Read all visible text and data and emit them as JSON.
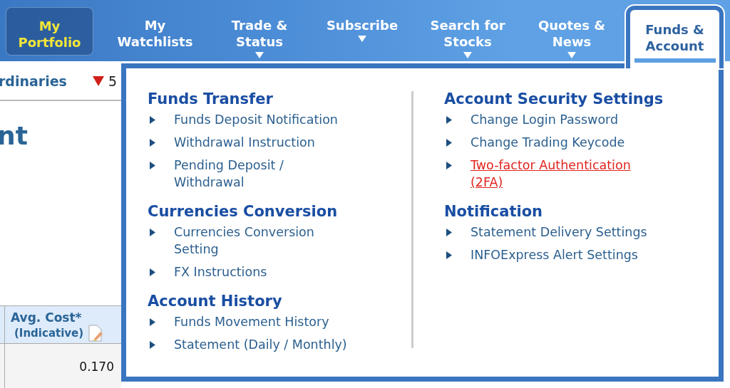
{
  "nav": {
    "tabs": [
      {
        "label": "My\nPortfolio",
        "current": true,
        "selected": false,
        "has_dropdown": false
      },
      {
        "label": "My\nWatchlists",
        "current": false,
        "selected": false,
        "has_dropdown": false
      },
      {
        "label": "Trade &\nStatus",
        "current": false,
        "selected": false,
        "has_dropdown": true
      },
      {
        "label": "Subscribe",
        "current": false,
        "selected": false,
        "has_dropdown": true
      },
      {
        "label": "Search for\nStocks",
        "current": false,
        "selected": false,
        "has_dropdown": true
      },
      {
        "label": "Quotes &\nNews",
        "current": false,
        "selected": false,
        "has_dropdown": true
      },
      {
        "label": "Funds &\nAccount",
        "current": false,
        "selected": true,
        "has_dropdown": false
      }
    ]
  },
  "background_page": {
    "index_name": "rdinaries",
    "index_change": "5",
    "title": "nt",
    "table": {
      "header": {
        "label": "Avg. Cost*",
        "sublabel": "(Indicative)"
      },
      "rows": [
        {
          "avg_cost": "0.170"
        }
      ]
    }
  },
  "dropdown_menu": {
    "columns": [
      {
        "sections": [
          {
            "heading": "Funds Transfer",
            "items": [
              {
                "label": "Funds Deposit Notification",
                "highlighted": false
              },
              {
                "label": "Withdrawal Instruction",
                "highlighted": false
              },
              {
                "label": "Pending Deposit /\nWithdrawal",
                "highlighted": false
              }
            ]
          },
          {
            "heading": "Currencies Conversion",
            "items": [
              {
                "label": "Currencies Conversion\nSetting",
                "highlighted": false
              },
              {
                "label": "FX Instructions",
                "highlighted": false
              }
            ]
          },
          {
            "heading": "Account History",
            "items": [
              {
                "label": "Funds Movement History",
                "highlighted": false
              },
              {
                "label": "Statement (Daily / Monthly)",
                "highlighted": false
              }
            ]
          }
        ]
      },
      {
        "sections": [
          {
            "heading": "Account Security Settings",
            "items": [
              {
                "label": "Change Login Password",
                "highlighted": false
              },
              {
                "label": "Change Trading Keycode",
                "highlighted": false
              },
              {
                "label": "Two-factor Authentication\n(2FA)",
                "highlighted": true
              }
            ]
          },
          {
            "heading": "Notification",
            "items": [
              {
                "label": "Statement Delivery Settings",
                "highlighted": false
              },
              {
                "label": "INFOExpress Alert Settings",
                "highlighted": false
              }
            ]
          }
        ]
      }
    ]
  }
}
